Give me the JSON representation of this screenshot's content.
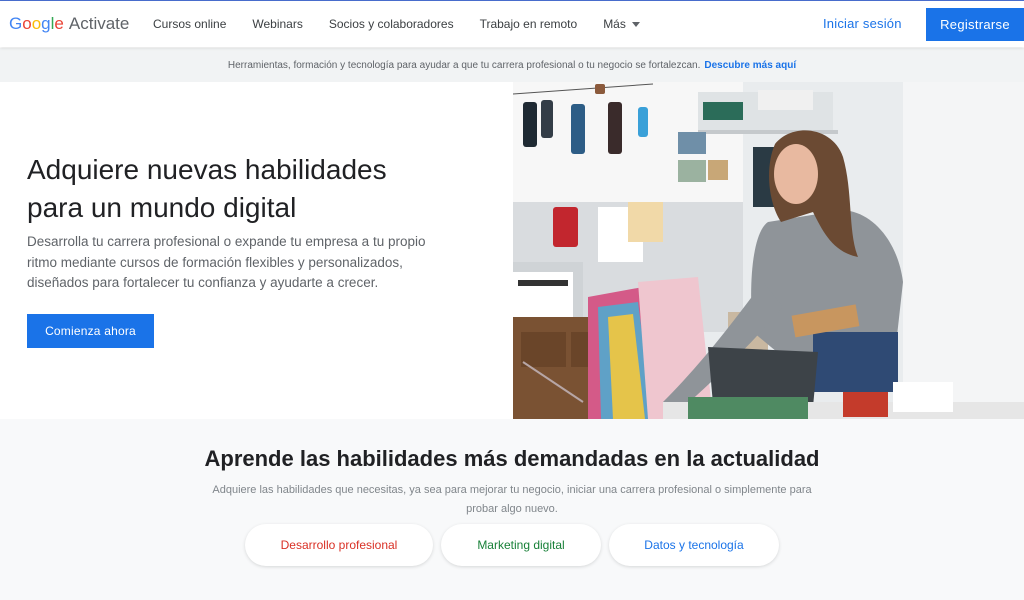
{
  "header": {
    "logo": {
      "google_letters": [
        {
          "char": "G",
          "color": "#4285F4"
        },
        {
          "char": "o",
          "color": "#EA4335"
        },
        {
          "char": "o",
          "color": "#FBBC05"
        },
        {
          "char": "g",
          "color": "#4285F4"
        },
        {
          "char": "l",
          "color": "#34A853"
        },
        {
          "char": "e",
          "color": "#EA4335"
        }
      ],
      "product": "Activate"
    },
    "nav": [
      {
        "label": "Cursos online"
      },
      {
        "label": "Webinars"
      },
      {
        "label": "Socios y colaboradores"
      },
      {
        "label": "Trabajo en remoto"
      },
      {
        "label": "Más",
        "icon": "caret-down-icon"
      }
    ],
    "signin_label": "Iniciar sesión",
    "register_label": "Registrarse"
  },
  "banner": {
    "text": "Herramientas, formación y tecnología para ayudar a que tu carrera profesional o tu negocio se fortalezcan.",
    "link_label": "Descubre más aquí"
  },
  "hero": {
    "title": "Adquiere nuevas habilidades para un mundo digital",
    "subtitle": "Desarrolla tu carrera profesional o expande tu empresa a tu propio ritmo mediante cursos de formación flexibles y personalizados, diseñados para fortalecer tu confianza y ayudarte a crecer.",
    "cta_label": "Comienza ahora"
  },
  "skills": {
    "title": "Aprende las habilidades más demandadas en la actualidad",
    "description": "Adquiere las habilidades que necesitas, ya sea para mejorar tu negocio, iniciar una carrera profesional o simplemente para probar algo nuevo.",
    "chips": [
      {
        "label": "Desarrollo profesional",
        "color": "#d93025"
      },
      {
        "label": "Marketing digital",
        "color": "#188038"
      },
      {
        "label": "Datos y tecnología",
        "color": "#1a73e8"
      }
    ]
  },
  "colors": {
    "accent": "#1a73e8"
  }
}
